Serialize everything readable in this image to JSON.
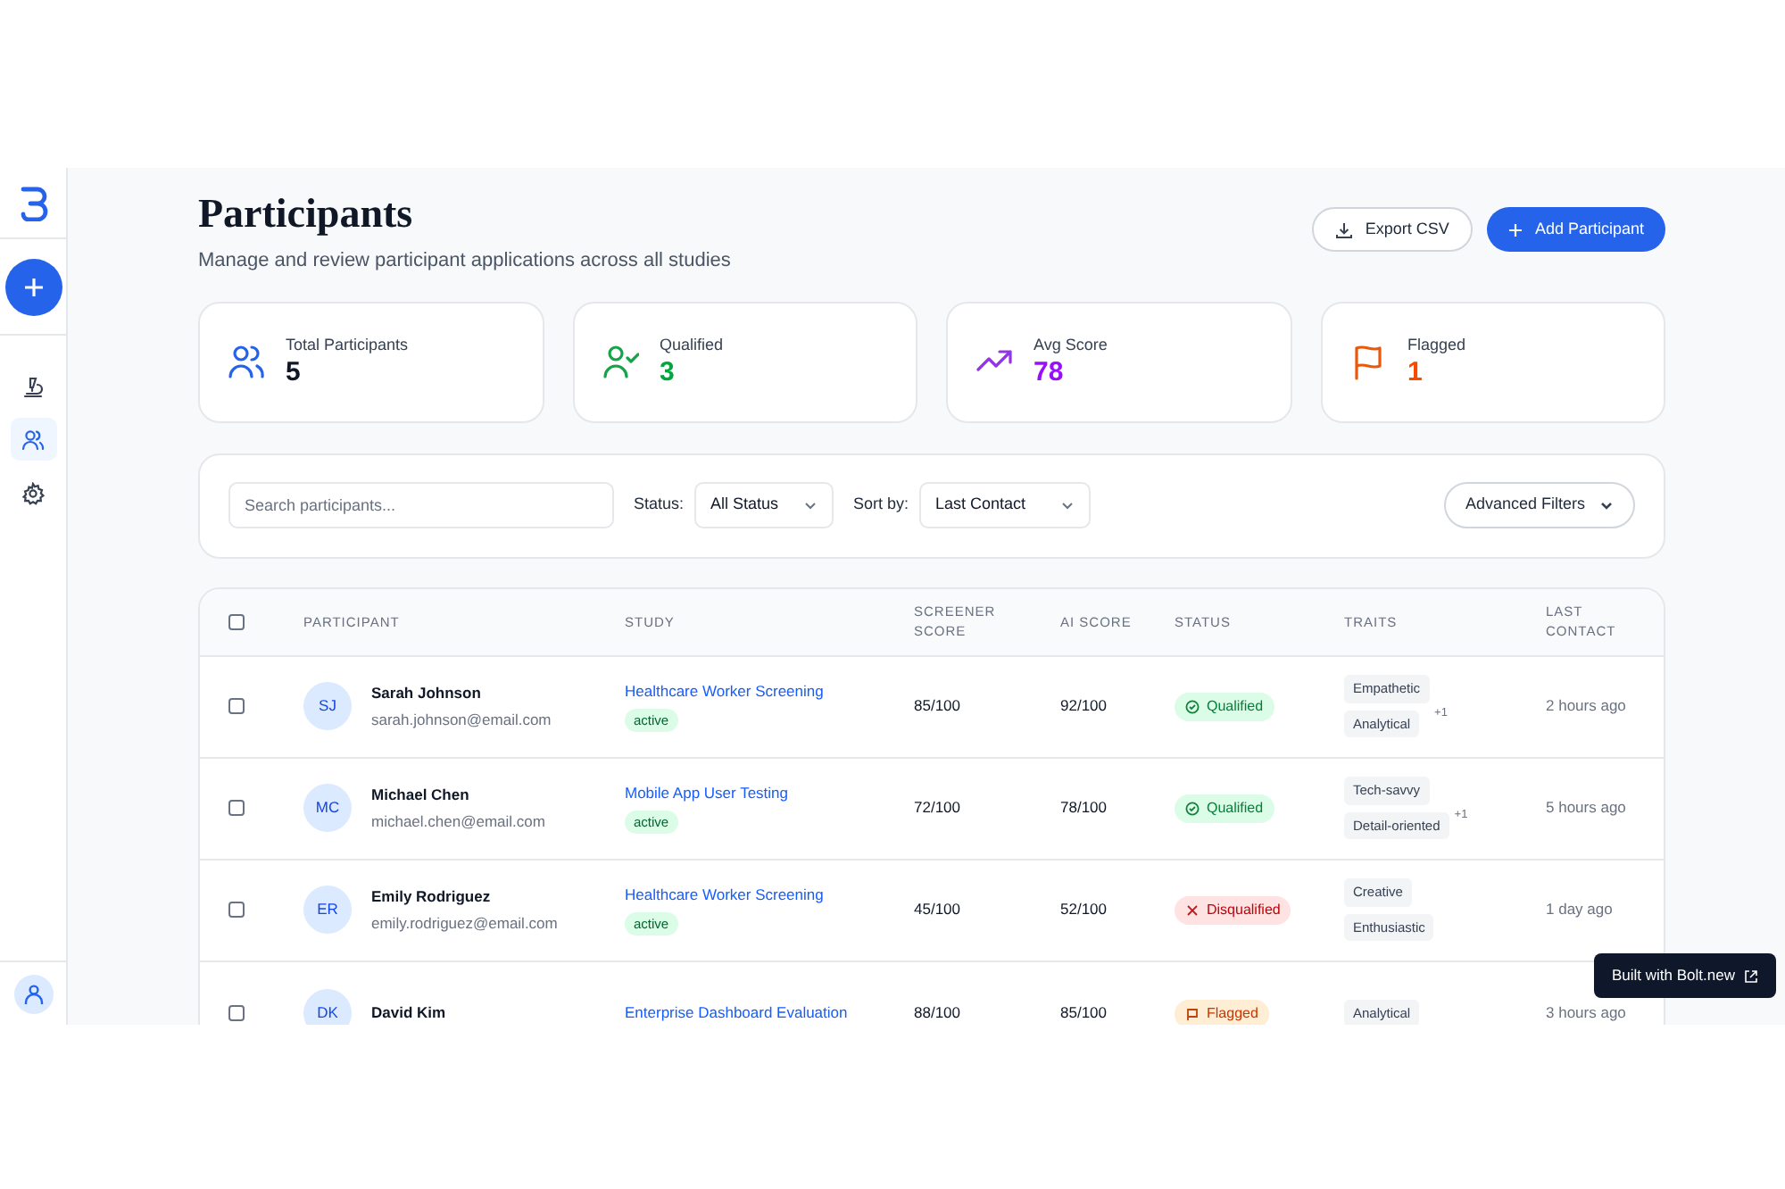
{
  "sidebar": {
    "items": [
      {
        "selected": false
      },
      {
        "selected": true
      },
      {
        "selected": false
      }
    ]
  },
  "header": {
    "title": "Participants",
    "subtitle": "Manage and review participant applications across all studies",
    "buttons": [
      {
        "label": "Export CSV",
        "kind": "secondary"
      },
      {
        "label": "Add Participant",
        "kind": "primary"
      }
    ]
  },
  "stats": [
    {
      "label": "Total Participants",
      "value": "5",
      "kind": "total"
    },
    {
      "label": "Qualified",
      "value": "3",
      "kind": "qualified"
    },
    {
      "label": "Avg Score",
      "value": "78",
      "kind": "score"
    },
    {
      "label": "Flagged",
      "value": "1",
      "kind": "flagged"
    }
  ],
  "filters": {
    "search": {
      "placeholder": "Search participants..."
    },
    "status": {
      "label": "Status:",
      "value": "All Status"
    },
    "sort": {
      "label": "Sort by:",
      "value": "Last Contact"
    },
    "advanced": "Advanced Filters"
  },
  "table": {
    "columns": [
      "PARTICIPANT",
      "STUDY",
      "SCREENER SCORE",
      "AI SCORE",
      "STATUS",
      "TRAITS",
      "LAST CONTACT"
    ],
    "all_checked": false,
    "rows": [
      {
        "checked": false,
        "initials": "SJ",
        "name": "Sarah Johnson",
        "email": "sarah.johnson@email.com",
        "study": "Healthcare Worker Screening",
        "study_state": "active",
        "screener": "85/100",
        "ai": "92/100",
        "status": {
          "label": "Qualified",
          "kind": "qualified"
        },
        "traits": [
          "Empathetic",
          "Analytical"
        ],
        "more": "+1",
        "last_contact": "2 hours ago"
      },
      {
        "checked": false,
        "initials": "MC",
        "name": "Michael Chen",
        "email": "michael.chen@email.com",
        "study": "Mobile App User Testing",
        "study_state": "active",
        "screener": "72/100",
        "ai": "78/100",
        "status": {
          "label": "Qualified",
          "kind": "qualified"
        },
        "traits": [
          "Tech-savvy",
          "Detail-oriented"
        ],
        "more": "+1",
        "last_contact": "5 hours ago"
      },
      {
        "checked": false,
        "initials": "ER",
        "name": "Emily Rodriguez",
        "email": "emily.rodriguez@email.com",
        "study": "Healthcare Worker Screening",
        "study_state": "active",
        "screener": "45/100",
        "ai": "52/100",
        "status": {
          "label": "Disqualified",
          "kind": "disqualified"
        },
        "traits": [
          "Creative",
          "Enthusiastic"
        ],
        "last_contact": "1 day ago"
      },
      {
        "checked": false,
        "initials": "DK",
        "name": "David Kim",
        "study": "Enterprise Dashboard Evaluation",
        "screener": "88/100",
        "ai": "85/100",
        "status": {
          "label": "Flagged",
          "kind": "flagged"
        },
        "traits": [
          "Analytical"
        ],
        "last_contact": "3 hours ago"
      }
    ]
  },
  "badge": {
    "label": "Built with Bolt.new"
  }
}
